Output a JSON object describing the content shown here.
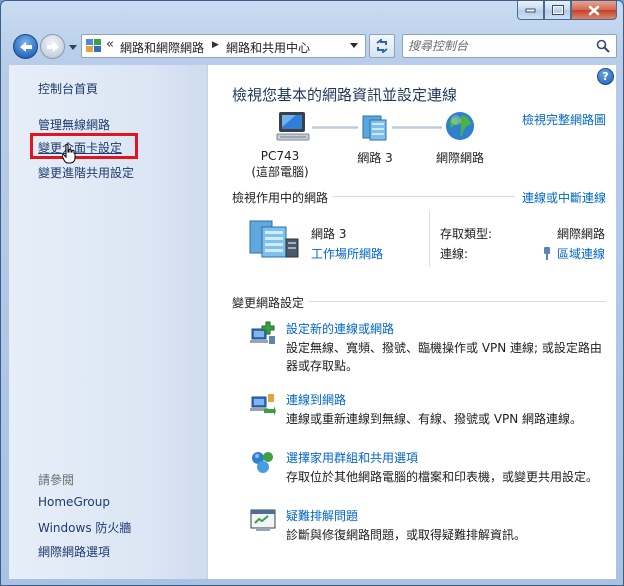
{
  "window": {
    "colors": {
      "accent": "#0066cc",
      "title": "#1e395b",
      "highlight": "#e4141e"
    }
  },
  "address": {
    "overflow": "«",
    "crumbs": [
      "網路和網際網路",
      "網路和共用中心"
    ],
    "search_placeholder": "搜尋控制台"
  },
  "sidebar": {
    "home": "控制台首頁",
    "links": [
      "管理無線網路",
      "變更介面卡設定",
      "變更進階共用設定"
    ],
    "see_also_title": "請參閱",
    "see_also": [
      "HomeGroup",
      "Windows 防火牆",
      "網際網路選項"
    ]
  },
  "main": {
    "title": "檢視您基本的網路資訊並設定連線",
    "full_map_link": "檢視完整網路圖",
    "map": {
      "computer_name": "PC743",
      "computer_sub": "(這部電腦)",
      "network": "網路  3",
      "internet": "網際網路"
    },
    "active_section": "檢視作用中的網路",
    "connect_link": "連線或中斷連線",
    "active_network": {
      "name": "網路  3",
      "type_link": "工作場所網路",
      "access_type_label": "存取類型:",
      "access_type_value": "網際網路",
      "connections_label": "連線:",
      "connections_value": "區域連線"
    },
    "change_section": "變更網路設定",
    "tasks": [
      {
        "title": "設定新的連線或網路",
        "desc": "設定無線、寬頻、撥號、臨機操作或 VPN 連線; 或設定路由器或存取點。",
        "icon": "new-connection-icon"
      },
      {
        "title": "連線到網路",
        "desc": "連線或重新連線到無線、有線、撥號或 VPN 網路連線。",
        "icon": "connect-network-icon"
      },
      {
        "title": "選擇家用群組和共用選項",
        "desc": "存取位於其他網路電腦的檔案和印表機，或變更共用設定。",
        "icon": "homegroup-icon"
      },
      {
        "title": "疑難排解問題",
        "desc": "診斷與修復網路問題，或取得疑難排解資訊。",
        "icon": "troubleshoot-icon"
      }
    ]
  }
}
